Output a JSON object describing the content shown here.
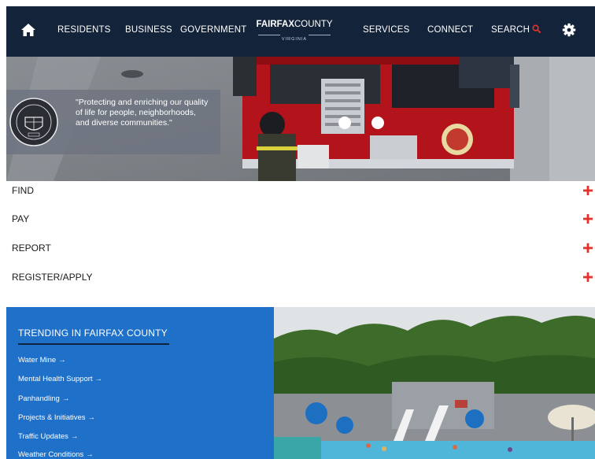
{
  "nav": {
    "items": [
      {
        "label": "RESIDENTS",
        "name": "nav-residents"
      },
      {
        "label": "BUSINESS",
        "name": "nav-business"
      },
      {
        "label": "GOVERNMENT",
        "name": "nav-government"
      },
      {
        "label": "SERVICES",
        "name": "nav-services"
      },
      {
        "label": "CONNECT",
        "name": "nav-connect"
      }
    ],
    "search_label": "SEARCH",
    "logo": {
      "bold": "FAIRFAX",
      "regular": "COUNTY",
      "sub": "VIRGINIA"
    },
    "icons": {
      "home": "home-icon",
      "search": "search-icon",
      "settings": "gear-icon"
    }
  },
  "hero": {
    "quote": "\"Protecting and enriching our quality of life for people, neighborhoods, and diverse communities.\"",
    "seal_icon": "county-seal"
  },
  "accordion": [
    {
      "label": "FIND"
    },
    {
      "label": "PAY"
    },
    {
      "label": "REPORT"
    },
    {
      "label": "REGISTER/APPLY"
    }
  ],
  "trending": {
    "title": "TRENDING IN FAIRFAX COUNTY",
    "links": [
      {
        "label": "Water Mine"
      },
      {
        "label": "Mental Health Support"
      },
      {
        "label": "Panhandling"
      },
      {
        "label": "Projects & Initiatives"
      },
      {
        "label": "Traffic Updates"
      },
      {
        "label": "Weather Conditions"
      }
    ]
  },
  "colors": {
    "nav_bg": "#13233a",
    "accent_red": "#e5312b",
    "trending_bg": "#1f70c8"
  }
}
